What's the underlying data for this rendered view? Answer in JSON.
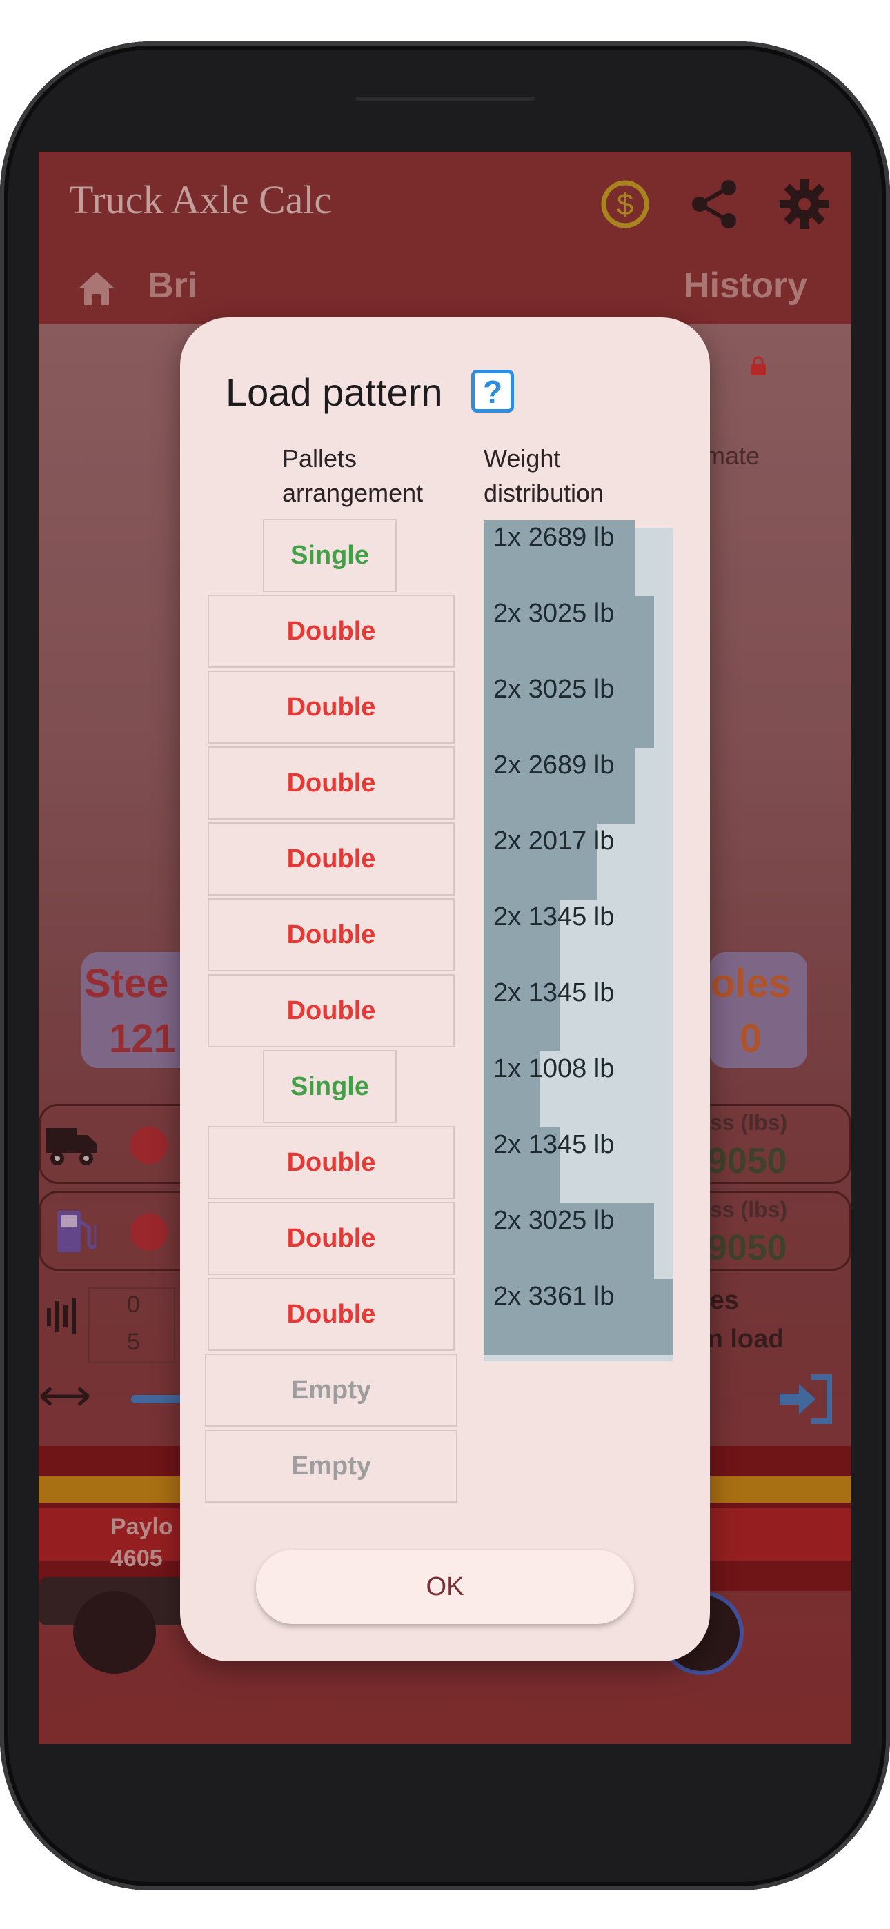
{
  "app": {
    "title": "Truck Axle Calc",
    "nav": {
      "bridge": "Bri",
      "history": "History",
      "estimate": "mate"
    },
    "background_text": {
      "steer": "Stee",
      "steer_value": "121",
      "poles": "oles",
      "poles_value": "0",
      "gross1_label": "ss (lbs)",
      "gross1_value": "9050",
      "gross2_label": "ss (lbs)",
      "gross2_value": "9050",
      "counter_top": "0",
      "counter_bottom": "5",
      "side_text_1": "les",
      "side_text_2": "m load",
      "payload_label": "Paylo",
      "payload_value": "4605"
    },
    "icons": [
      "dollar-icon",
      "share-icon",
      "gear-icon",
      "home-icon",
      "history-icon",
      "lock-icon",
      "truck-icon",
      "fuel-icon",
      "arrows-icon",
      "login-icon"
    ]
  },
  "dialog": {
    "title": "Load pattern",
    "help_label": "?",
    "col_pallets": [
      "Pallets",
      "arrangement"
    ],
    "col_weight": [
      "Weight",
      "distribution"
    ],
    "rows": [
      {
        "arrangement": "Single",
        "type": "single",
        "weight": "1x 2689 lb",
        "ratio": 0.8
      },
      {
        "arrangement": "Double",
        "type": "double",
        "weight": "2x 3025 lb",
        "ratio": 0.9
      },
      {
        "arrangement": "Double",
        "type": "double",
        "weight": "2x 3025 lb",
        "ratio": 0.9
      },
      {
        "arrangement": "Double",
        "type": "double",
        "weight": "2x 2689 lb",
        "ratio": 0.8
      },
      {
        "arrangement": "Double",
        "type": "double",
        "weight": "2x 2017 lb",
        "ratio": 0.6
      },
      {
        "arrangement": "Double",
        "type": "double",
        "weight": "2x 1345 lb",
        "ratio": 0.4
      },
      {
        "arrangement": "Double",
        "type": "double",
        "weight": "2x 1345 lb",
        "ratio": 0.4
      },
      {
        "arrangement": "Single",
        "type": "single",
        "weight": "1x 1008 lb",
        "ratio": 0.3
      },
      {
        "arrangement": "Double",
        "type": "double",
        "weight": "2x 1345 lb",
        "ratio": 0.4
      },
      {
        "arrangement": "Double",
        "type": "double",
        "weight": "2x 3025 lb",
        "ratio": 0.9
      },
      {
        "arrangement": "Double",
        "type": "double",
        "weight": "2x 3361 lb",
        "ratio": 1.0
      },
      {
        "arrangement": "Empty",
        "type": "empty"
      },
      {
        "arrangement": "Empty",
        "type": "empty"
      }
    ],
    "ok_label": "OK"
  }
}
